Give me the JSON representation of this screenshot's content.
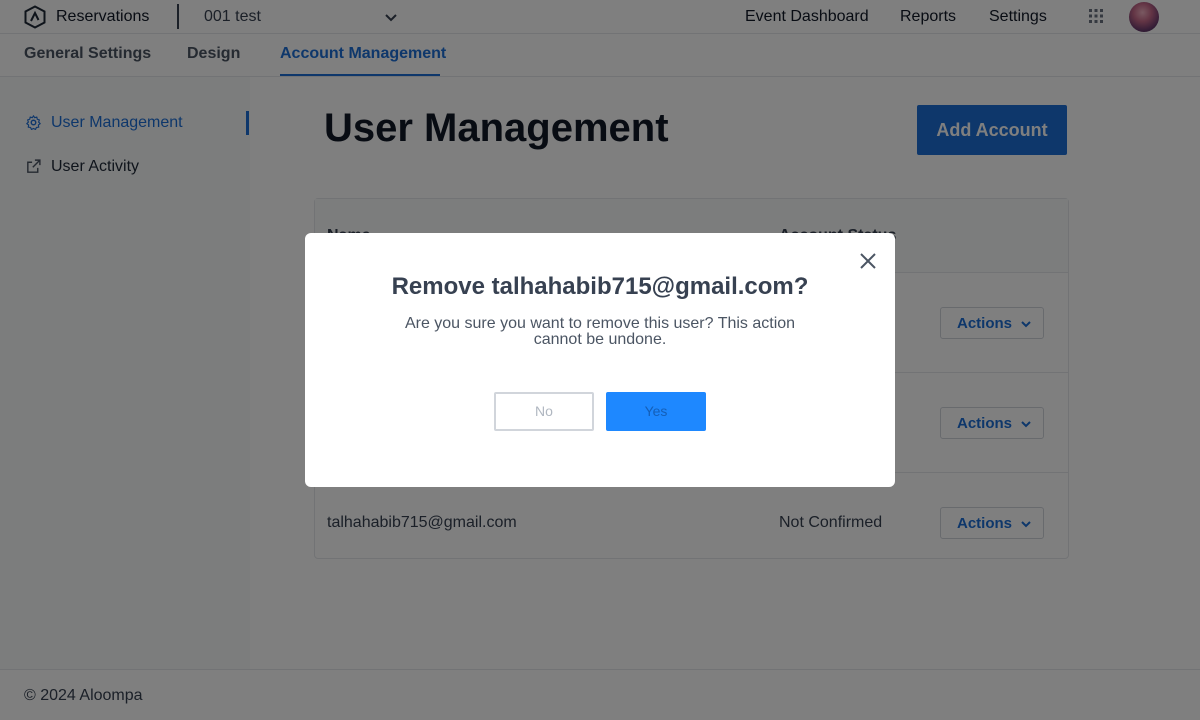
{
  "app": {
    "name": "Reservations",
    "venue": "001 test"
  },
  "nav": {
    "event_dashboard": "Event Dashboard",
    "reports": "Reports",
    "settings": "Settings"
  },
  "tabs": [
    {
      "label": "General Settings"
    },
    {
      "label": "Design"
    },
    {
      "label": "Account Management",
      "active": true
    }
  ],
  "sidebar": {
    "items": [
      {
        "label": "User Management",
        "icon": "gear-icon",
        "active": true
      },
      {
        "label": "User Activity",
        "icon": "external-link-icon"
      }
    ]
  },
  "main": {
    "title": "User Management",
    "add_button": "Add Account",
    "table": {
      "headers": {
        "name": "Name",
        "status": "Account Status"
      },
      "rows": [
        {
          "email": "",
          "status": "",
          "action": "Actions"
        },
        {
          "email": "",
          "status": "",
          "action": "Actions"
        },
        {
          "email": "talhahabib715@gmail.com",
          "status": "Not Confirmed",
          "action": "Actions"
        }
      ]
    }
  },
  "footer": {
    "copyright": "© 2024 Aloompa"
  },
  "modal": {
    "title": "Remove talhahabib715@gmail.com?",
    "message": "Are you sure you want to remove this user? This action cannot be undone.",
    "no_label": "No",
    "yes_label": "Yes"
  },
  "colors": {
    "accent": "#1d6fd6",
    "yes_button": "#1e88ff",
    "overlay": "rgba(0,0,0,0.5)"
  }
}
